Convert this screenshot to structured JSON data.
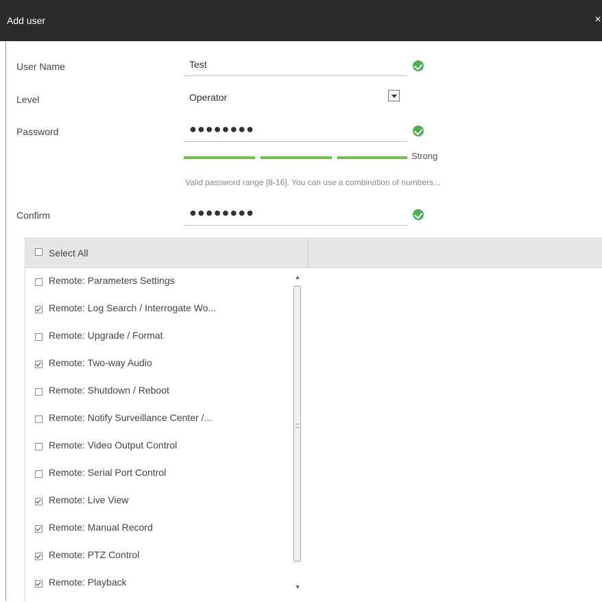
{
  "window": {
    "title": "Add user",
    "close_label": "×"
  },
  "form": {
    "user_name": {
      "label": "User Name",
      "value": "Test"
    },
    "level": {
      "label": "Level",
      "value": "Operator"
    },
    "password": {
      "label": "Password",
      "value": "●●●●●●●●",
      "strength": "Strong",
      "strength_level_fraction": 1.0,
      "hint": "Valid password range [8-16]. You can use a combination of numbers..."
    },
    "confirm": {
      "label": "Confirm",
      "value": "●●●●●●●●"
    }
  },
  "permissions": {
    "select_all_label": "Select All",
    "select_all_checked": false,
    "items": [
      {
        "label": "Remote: Parameters Settings",
        "checked": false
      },
      {
        "label": "Remote: Log Search / Interrogate Wo...",
        "checked": true
      },
      {
        "label": "Remote: Upgrade / Format",
        "checked": false
      },
      {
        "label": "Remote: Two-way Audio",
        "checked": true
      },
      {
        "label": "Remote: Shutdown / Reboot",
        "checked": false
      },
      {
        "label": "Remote: Notify Surveillance Center /...",
        "checked": false
      },
      {
        "label": "Remote: Video Output Control",
        "checked": false
      },
      {
        "label": "Remote: Serial Port Control",
        "checked": false
      },
      {
        "label": "Remote: Live View",
        "checked": true
      },
      {
        "label": "Remote: Manual Record",
        "checked": true
      },
      {
        "label": "Remote: PTZ Control",
        "checked": true
      },
      {
        "label": "Remote: Playback",
        "checked": true
      }
    ]
  },
  "colors": {
    "titlebar": "#2b2b2b",
    "accent_green": "#4caf50",
    "strength_bar": "#6cc04a"
  }
}
